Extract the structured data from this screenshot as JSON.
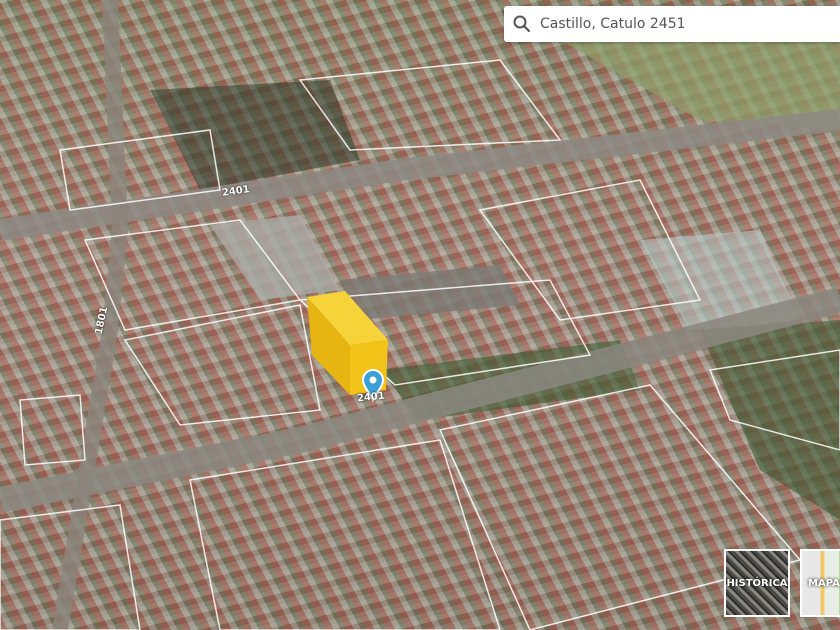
{
  "search": {
    "value": "Castillo, Catulo 2451",
    "icon": "search-icon"
  },
  "street_labels": [
    "2401",
    "1801",
    "2401"
  ],
  "marker": {
    "icon": "map-pin-icon",
    "color": "#3aa0d8"
  },
  "highlight_building_color": "#f2c318",
  "layers": {
    "historica": "HISTÓRICA",
    "mapa": "MAPA"
  }
}
